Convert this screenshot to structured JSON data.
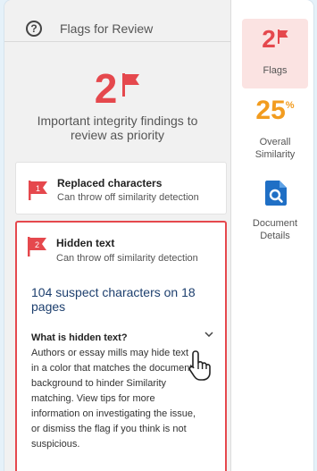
{
  "header": {
    "title": "Flags for Review",
    "help_glyph": "?"
  },
  "summary": {
    "count": "2",
    "text": "Important integrity findings to review as priority"
  },
  "flags": [
    {
      "number": "1",
      "title": "Replaced characters",
      "subtitle": "Can throw off similarity detection"
    },
    {
      "number": "2",
      "title": "Hidden text",
      "subtitle": "Can throw off similarity detection",
      "detail": "104 suspect characters on 18 pages",
      "question": "What is hidden text?",
      "answer": "Authors or essay mills may hide text in a color that matches the document background to hinder Similarity matching. View tips for more information on investigating the issue, or dismiss the flag if you think is not suspicious."
    }
  ],
  "sidebar": {
    "flags_count": "2",
    "flags_label": "Flags",
    "similarity_value": "25",
    "similarity_unit": "%",
    "similarity_label": "Overall Similarity",
    "document_label": "Document Details"
  },
  "colors": {
    "flag_red": "#e5484d",
    "similarity_orange": "#f29c1f",
    "doc_blue": "#1f6fc5",
    "link_navy": "#1d3f6e"
  },
  "icons": [
    "help-icon",
    "flag-icon",
    "chevron-down-icon",
    "hand-cursor-icon",
    "document-search-icon"
  ]
}
